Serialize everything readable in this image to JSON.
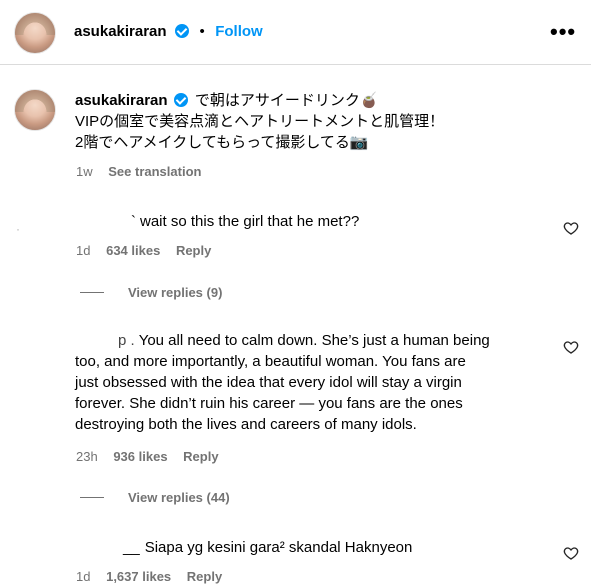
{
  "header": {
    "username": "asukakiraran",
    "separator": "•",
    "follow_label": "Follow",
    "more_label": "•••"
  },
  "caption": {
    "username": "asukakiraran",
    "lines": [
      "で朝はアサイードリンク🧉",
      "VIPの個室で美容点滴とヘアトリートメントと肌管理！",
      "2階でヘアメイクしてもらって撮影してる📷"
    ],
    "time": "1w",
    "see_translation": "See translation"
  },
  "comments": [
    {
      "name_fragment": "`",
      "text": "wait so this the girl that he met??",
      "time": "1d",
      "likes": "634 likes",
      "reply_label": "Reply",
      "view_replies": "View replies (9)"
    },
    {
      "name_fragment": "p .",
      "lines": [
        "You all need to calm down. She’s just a human being",
        "too, and more importantly, a beautiful woman. You fans are",
        "just obsessed with the idea that every idol will stay a virgin",
        "forever. She didn’t ruin his career — you fans are the ones",
        "destroying both the lives and careers of many idols."
      ],
      "time": "23h",
      "likes": "936 likes",
      "reply_label": "Reply",
      "view_replies": "View replies (44)"
    },
    {
      "name_fragment": "__",
      "text": "Siapa yg kesini gara² skandal Haknyeon",
      "time": "1d",
      "likes": "1,637 likes",
      "reply_label": "Reply"
    }
  ]
}
